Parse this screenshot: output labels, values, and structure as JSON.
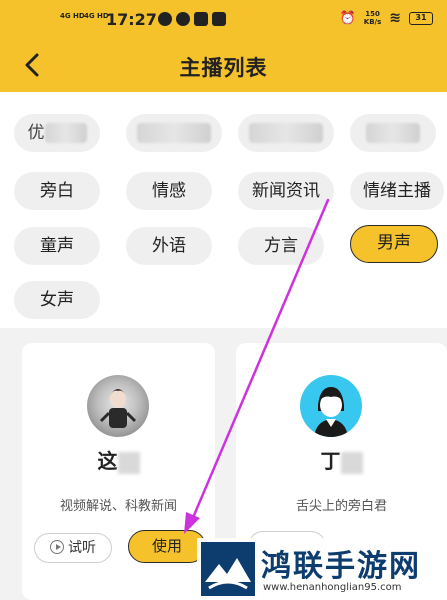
{
  "status_bar": {
    "net1": "4G HD",
    "net2": "4G HD",
    "time": "17:27",
    "speed_top": "150",
    "speed_bottom": "KB/s",
    "battery": "31"
  },
  "header": {
    "back_icon": "chevron-left-icon",
    "title": "主播列表"
  },
  "tags": [
    {
      "label": "优",
      "blurred": true
    },
    {
      "label": "",
      "blurred": true
    },
    {
      "label": "",
      "blurred": true
    },
    {
      "label": "",
      "blurred": true
    },
    {
      "label": "旁白"
    },
    {
      "label": "情感"
    },
    {
      "label": "新闻资讯"
    },
    {
      "label": "情绪主播"
    },
    {
      "label": "童声"
    },
    {
      "label": "外语"
    },
    {
      "label": "方言"
    },
    {
      "label": "男声",
      "active": true
    },
    {
      "label": "女声"
    }
  ],
  "cards": [
    {
      "name_visible": "这",
      "description": "视频解说、科教新闻",
      "try_label": "试听",
      "use_label": "使用"
    },
    {
      "name_visible": "丁",
      "description": "舌尖上的旁白君"
    }
  ],
  "watermark": {
    "title": "鸿联手游网",
    "url": "www.henanhonglian95.com"
  },
  "colors": {
    "accent": "#f6c22c",
    "arrow": "#cc33dd",
    "watermark_blue": "#0d3d6e"
  }
}
